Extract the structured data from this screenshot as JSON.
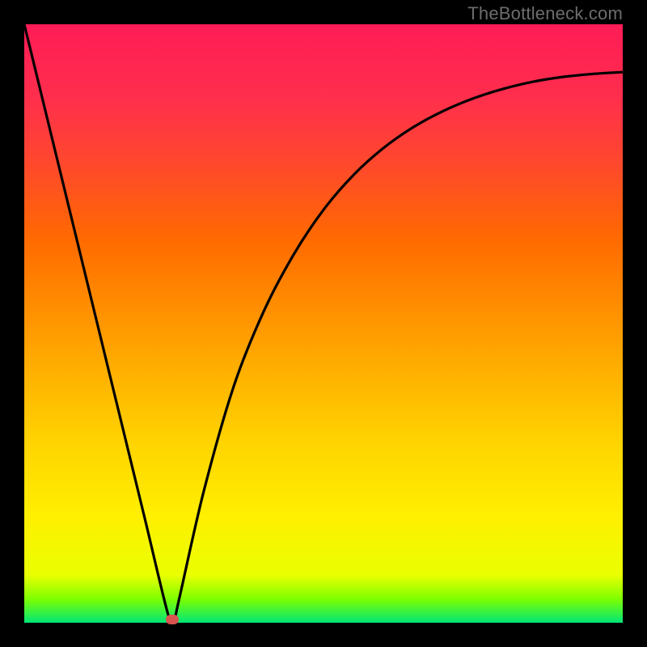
{
  "attribution": "TheBottleneck.com",
  "chart_data": {
    "type": "line",
    "title": "",
    "xlabel": "",
    "ylabel": "",
    "ylim": [
      0,
      100
    ],
    "xlim": [
      0,
      100
    ],
    "x": [
      0,
      5,
      10,
      15,
      20,
      24,
      25,
      26,
      30,
      35,
      40,
      45,
      50,
      55,
      60,
      65,
      70,
      75,
      80,
      85,
      90,
      95,
      100
    ],
    "values": [
      100,
      79.5,
      59,
      38.5,
      18,
      1.5,
      0.5,
      4.5,
      22,
      39.5,
      52,
      61.5,
      69,
      74.8,
      79.3,
      82.8,
      85.5,
      87.6,
      89.2,
      90.4,
      91.2,
      91.7,
      92
    ],
    "marker": {
      "x": 24.7,
      "y": 0.6
    },
    "annotations": []
  },
  "colors": {
    "curve": "#000000",
    "marker": "#d9534f"
  }
}
